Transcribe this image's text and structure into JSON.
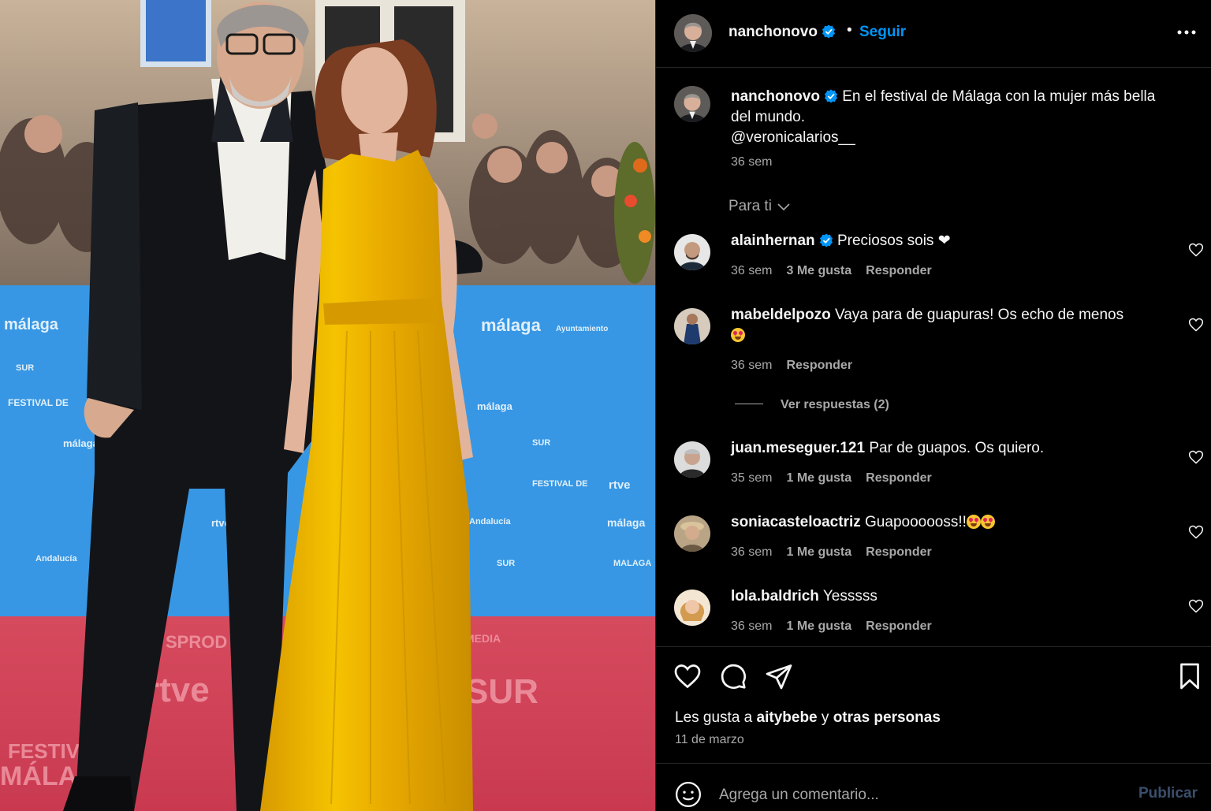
{
  "post": {
    "author": "nanchonovo",
    "follow_label": "Seguir",
    "dot": "•"
  },
  "caption": {
    "author": "nanchonovo",
    "line1": "En el festival de Málaga con la mujer más bella",
    "line2": "del mundo.",
    "mention": "@veronicalarios__",
    "time": "36 sem"
  },
  "filter_label": "Para ti",
  "comments": [
    {
      "user": "alainhernan",
      "verified": true,
      "text": "Preciosos sois ❤",
      "time": "36 sem",
      "likes": "3 Me gusta",
      "reply": "Responder"
    },
    {
      "user": "mabeldelpozo",
      "verified": false,
      "text": "Vaya para de guapuras! Os echo de menos",
      "time": "36 sem",
      "likes": "",
      "reply": "Responder"
    },
    {
      "user": "juan.meseguer.121",
      "verified": false,
      "text": "Par de guapos. Os quiero.",
      "time": "35 sem",
      "likes": "1 Me gusta",
      "reply": "Responder"
    },
    {
      "user": "soniacasteloactriz",
      "verified": false,
      "text": "Guapoooooss!!",
      "time": "36 sem",
      "likes": "1 Me gusta",
      "reply": "Responder"
    },
    {
      "user": "lola.baldrich",
      "verified": false,
      "text": "Yesssss",
      "time": "36 sem",
      "likes": "1 Me gusta",
      "reply": "Responder"
    }
  ],
  "view_replies": "Ver respuestas (2)",
  "likes_line": {
    "prefix": "Les gusta a",
    "user": "aitybebe",
    "middle": "y",
    "rest": "otras personas"
  },
  "date": "11 de marzo",
  "add_comment": {
    "placeholder": "Agrega un comentario...",
    "publish": "Publicar"
  },
  "colors": {
    "accent": "#0095f6",
    "verified": "#0095f6",
    "muted": "#a8a8a8",
    "background": "#000000"
  },
  "icons": [
    "verified-badge-icon",
    "more-options-icon",
    "chevron-down-icon",
    "heart-icon",
    "comment-icon",
    "share-icon",
    "bookmark-icon",
    "emoji-icon"
  ]
}
